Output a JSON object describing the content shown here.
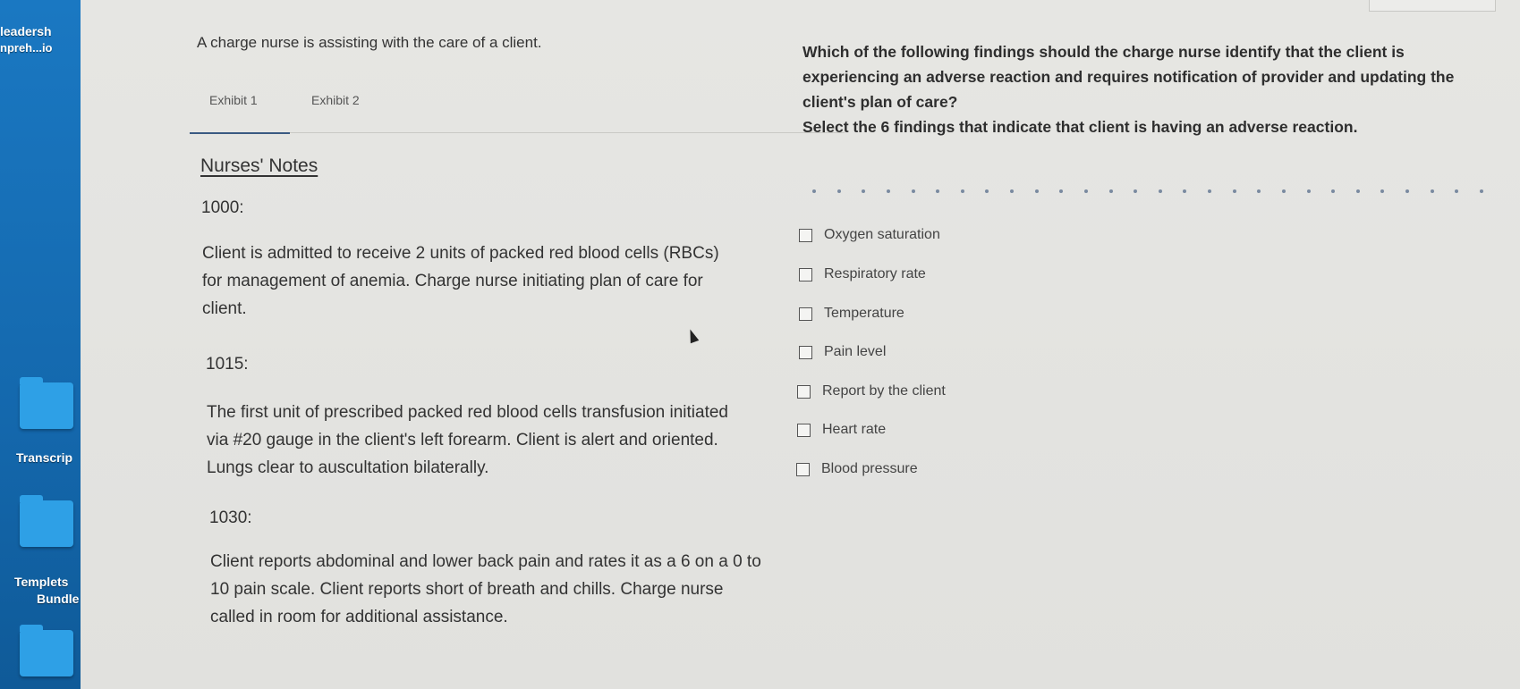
{
  "desktop": {
    "labels": [
      "leadersh",
      "npreh...io",
      "Transcrip",
      "Templets",
      "Bundle"
    ]
  },
  "passage": {
    "intro": "A charge nurse is assisting with the care of a client.",
    "tabs": [
      "Exhibit 1",
      "Exhibit 2"
    ],
    "active_tab": "Exhibit 1",
    "heading": "Nurses' Notes",
    "entries": [
      {
        "time": "1000:",
        "text": "Client is admitted to receive 2 units of packed red blood cells (RBCs) for management of anemia. Charge nurse initiating plan of care for client."
      },
      {
        "time": "1015:",
        "text": "The first unit of prescribed packed red blood cells transfusion initiated via #20 gauge in the client's left forearm. Client is alert and oriented. Lungs clear to auscultation bilaterally."
      },
      {
        "time": "1030:",
        "text": "Client reports abdominal and lower back pain and rates it as a 6 on a 0 to 10 pain scale. Client reports short of breath and chills. Charge nurse called in room for additional assistance."
      }
    ]
  },
  "question": {
    "prompt": "Which of the following findings should the charge nurse identify that the client is experiencing an adverse reaction and requires notification of provider and updating the client's plan of care?",
    "instruction": "Select the 6 findings that indicate that client is having an adverse reaction.",
    "options": [
      "Oxygen saturation",
      "Respiratory rate",
      "Temperature",
      "Pain level",
      "Report by the client",
      "Heart rate",
      "Blood pressure"
    ]
  }
}
